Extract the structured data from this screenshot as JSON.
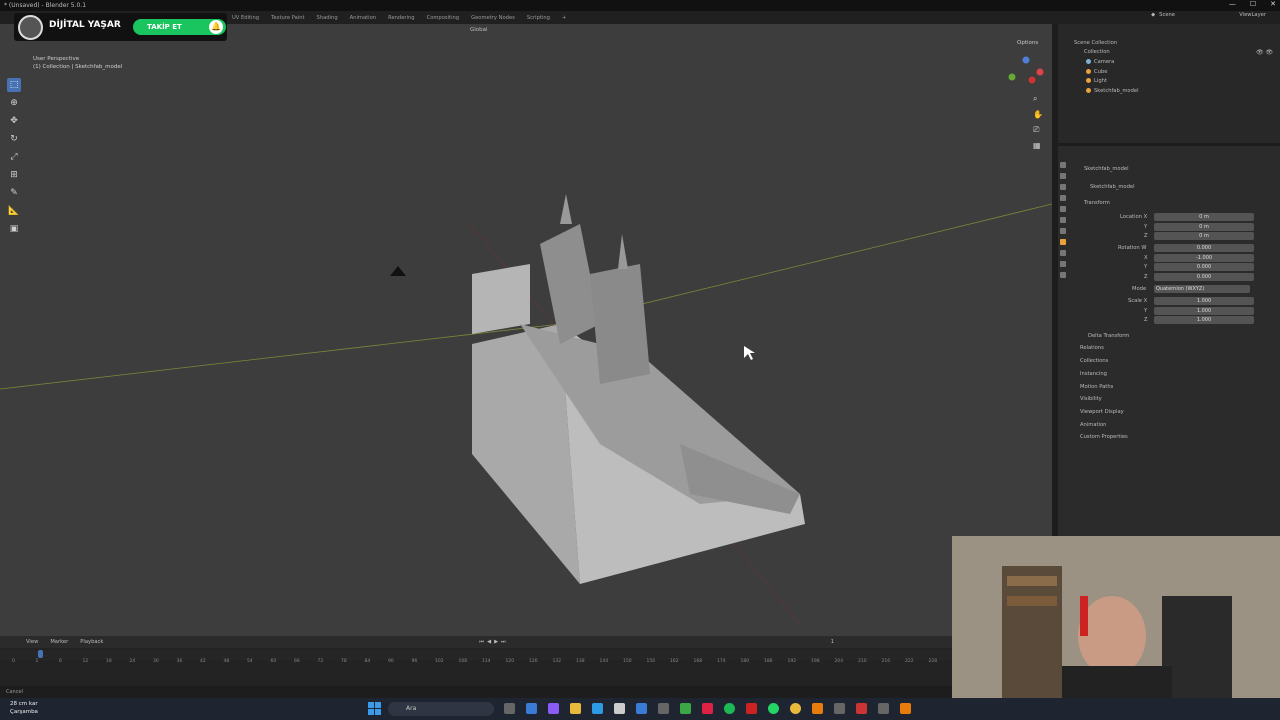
{
  "window": {
    "title": "* (Unsaved) - Blender 5.0.1"
  },
  "workspaces": [
    "UV Editing",
    "Texture Paint",
    "Shading",
    "Animation",
    "Rendering",
    "Compositing",
    "Geometry Nodes",
    "Scripting",
    "+"
  ],
  "scene": {
    "label": "Scene",
    "view_layer": "ViewLayer"
  },
  "promo": {
    "name": "DİJİTAL YAŞAR",
    "button": "TAKİP ET"
  },
  "viewport": {
    "info_line1": "User Perspective",
    "info_line2": "(1) Collection | Sketchfab_model",
    "orientation": "Global",
    "options": "Options"
  },
  "outliner": {
    "root": "Scene Collection",
    "collection": "Collection",
    "items": [
      {
        "name": "Camera",
        "color": "#7fb3d6"
      },
      {
        "name": "Cube",
        "color": "#e8a33c"
      },
      {
        "name": "Light",
        "color": "#e8a33c"
      },
      {
        "name": "Sketchfab_model",
        "color": "#e8a33c"
      }
    ]
  },
  "properties": {
    "object_name": "Sketchfab_model",
    "object_name2": "Sketchfab_model",
    "transform": "Transform",
    "location": {
      "label": "Location X",
      "x": "0 m",
      "y": "0 m",
      "z": "0 m"
    },
    "rotation": {
      "label": "Rotation W",
      "w": "0.000",
      "x": "-1.000",
      "y": "0.000",
      "z": "0.000"
    },
    "mode_label": "Mode",
    "mode_value": "Quaternion (WXYZ)",
    "scale": {
      "label": "Scale X",
      "x": "1.000",
      "y": "1.000",
      "z": "1.000"
    },
    "axis_y": "Y",
    "axis_z": "Z",
    "axis_x": "X",
    "sections": [
      "Delta Transform",
      "Relations",
      "Collections",
      "Instancing",
      "Motion Paths",
      "Visibility",
      "Viewport Display",
      "Animation",
      "Custom Properties"
    ]
  },
  "timeline": {
    "menus": [
      "View",
      "Marker",
      "Playback"
    ],
    "frame": "1",
    "ticks": [
      "0",
      "1",
      "6",
      "12",
      "18",
      "24",
      "30",
      "36",
      "42",
      "48",
      "54",
      "60",
      "66",
      "72",
      "78",
      "84",
      "90",
      "96",
      "102",
      "108",
      "114",
      "120",
      "126",
      "132",
      "138",
      "144",
      "150",
      "156",
      "162",
      "168",
      "174",
      "180",
      "186",
      "192",
      "198",
      "204",
      "210",
      "216",
      "222",
      "228"
    ]
  },
  "status": {
    "text": "Cancel"
  },
  "taskbar": {
    "weather_temp": "28 cm kar",
    "weather_day": "Çarşamba",
    "search": "Ara"
  }
}
